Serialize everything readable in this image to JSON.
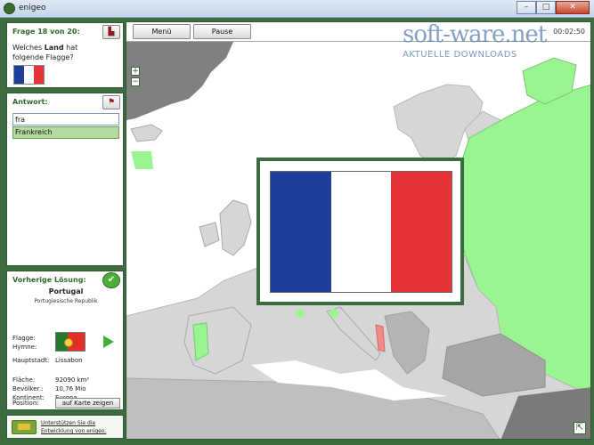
{
  "window": {
    "title": "enigeo",
    "minimize": "–",
    "maximize": "□",
    "close": "✕"
  },
  "question": {
    "counter": "Frage 18 von 20:",
    "line1_pre": "Welches ",
    "line1_bold": "Land",
    "line1_post": " hat",
    "line2": "folgende Flagge?",
    "flag_colors": [
      "#1f3e98",
      "#ffffff",
      "#e8323a"
    ]
  },
  "answer": {
    "title": "Antwort:",
    "input_value": "fra",
    "suggestion": "Frankreich"
  },
  "previous": {
    "title": "Vorherige Lösung:",
    "country": "Portugal",
    "full_name": "Portugiesische Republik",
    "flag_label": "Flagge:",
    "anthem_label": "Hymne:",
    "capital_label": "Hauptstadt:",
    "capital": "Lissabon",
    "area_label": "Fläche:",
    "area": "92090 km²",
    "population_label": "Bevölker.:",
    "population": "10,76 Mio",
    "continent_label": "Kontinent:",
    "continent": "Europa",
    "position_label": "Position:",
    "show_map": "auf Karte zeigen"
  },
  "support": {
    "line1": "Unterstützen Sie die",
    "line2": "Entwicklung von enigeo."
  },
  "toolbar": {
    "menu": "Menü",
    "pause": "Pause",
    "timer": "00:02:50"
  },
  "watermark": {
    "brand": "soft-ware.net",
    "tagline": "AKTUELLE DOWNLOADS"
  },
  "map": {
    "zoom_in": "+",
    "zoom_out": "−",
    "corner": "⇱"
  },
  "popup": {
    "flag_colors": [
      "#1f3e98",
      "#ffffff",
      "#e8323a"
    ]
  },
  "colors": {
    "frame": "#3d6b40",
    "accent": "#2e6b2a",
    "land": "#d6d6d6",
    "sea": "#ffffff",
    "answered": "#98f590",
    "highlight": "#f28a8a"
  }
}
